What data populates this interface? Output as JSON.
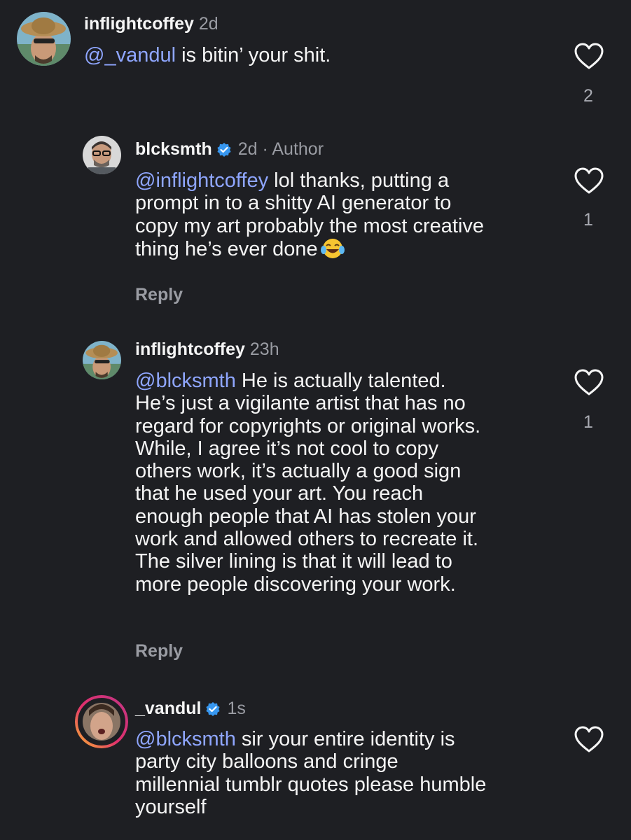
{
  "comments": [
    {
      "username": "inflightcoffey",
      "meta": "2d",
      "mention": "@_vandul",
      "text": " is bitin’ your shit.",
      "like_count": "2",
      "avatar_icon": "avatar-photo-hat"
    },
    {
      "username": "blcksmth",
      "verified": true,
      "meta": "2d · Author",
      "mention": "@inflightcoffey",
      "text": " lol thanks, putting a",
      "lines": [
        "prompt in to a shitty AI generator to",
        "copy my art probably the most creative",
        "thing he’s ever done"
      ],
      "emoji": "😂",
      "reply_label": "Reply",
      "like_count": "1",
      "avatar_icon": "avatar-photo-glasses"
    },
    {
      "username": "inflightcoffey",
      "meta": "23h",
      "mention": "@blcksmth",
      "text": " He is actually talented.",
      "lines": [
        "He’s just a vigilante artist that has no",
        "regard for copyrights or original works.",
        "While, I agree it’s not cool to copy",
        "others work, it’s actually a good sign",
        "that he used your art. You reach",
        "enough people that AI has stolen your",
        "work and allowed others to recreate it.",
        "The silver lining is that it will lead to",
        "more people discovering your work."
      ],
      "reply_label": "Reply",
      "like_count": "1",
      "avatar_icon": "avatar-photo-hat"
    },
    {
      "username": "_vandul",
      "verified": true,
      "meta": "1s",
      "mention": "@blcksmth",
      "text": " sir your entire identity is",
      "lines": [
        "party city balloons and cringe",
        "millennial tumblr quotes please humble",
        "yourself"
      ],
      "avatar_icon": "avatar-photo-story-ring"
    }
  ],
  "colors": {
    "background": "#1e1f23",
    "mention": "#8fa6ff",
    "secondary_text": "#9a9ca3",
    "verified": "#3797f0"
  }
}
